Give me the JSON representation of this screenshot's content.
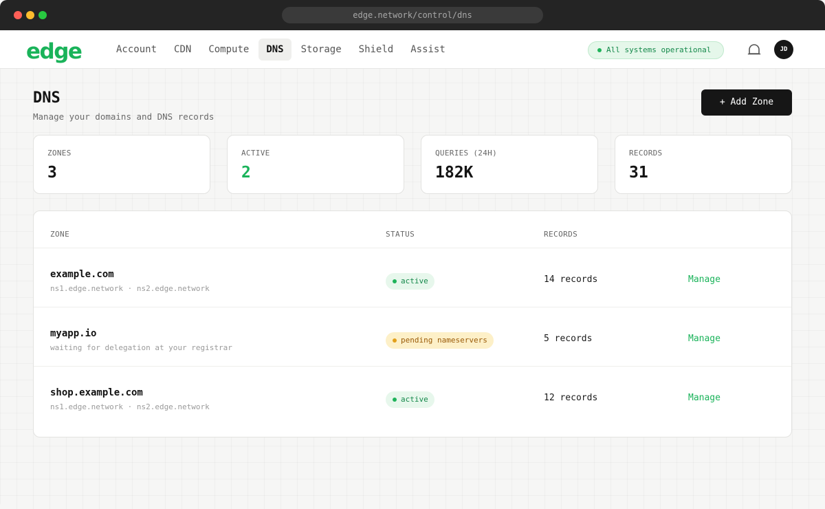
{
  "browser": {
    "url": "edge.network/control/dns"
  },
  "brand": {
    "logo_text": "edge",
    "accent": "#1ab35a"
  },
  "nav": {
    "items": [
      {
        "label": "Account"
      },
      {
        "label": "CDN"
      },
      {
        "label": "Compute"
      },
      {
        "label": "DNS",
        "active": true
      },
      {
        "label": "Storage"
      },
      {
        "label": "Shield"
      },
      {
        "label": "Assist"
      }
    ]
  },
  "system_status": {
    "label": "All systems operational",
    "color": "#1fb35a"
  },
  "user": {
    "initials": "JD"
  },
  "page": {
    "title": "DNS",
    "subtitle": "Manage your domains and DNS records",
    "add_button": "+ Add Zone"
  },
  "stats": [
    {
      "label": "ZONES",
      "value": "3"
    },
    {
      "label": "ACTIVE",
      "value": "2"
    },
    {
      "label": "QUERIES (24H)",
      "value": "182K"
    },
    {
      "label": "RECORDS",
      "value": "31"
    }
  ],
  "table": {
    "headers": {
      "zone": "ZONE",
      "status": "STATUS",
      "records": "RECORDS"
    },
    "rows": [
      {
        "zone": "example.com",
        "detail": "ns1.edge.network · ns2.edge.network",
        "status": "active",
        "records": "14 records",
        "action": "Manage"
      },
      {
        "zone": "myapp.io",
        "detail": "waiting for delegation at your registrar",
        "status": "pending nameservers",
        "records": "5 records",
        "action": "Manage"
      },
      {
        "zone": "shop.example.com",
        "detail": "ns1.edge.network · ns2.edge.network",
        "status": "active",
        "records": "12 records",
        "action": "Manage"
      }
    ]
  },
  "icons": [
    "bell-icon",
    "logo"
  ]
}
